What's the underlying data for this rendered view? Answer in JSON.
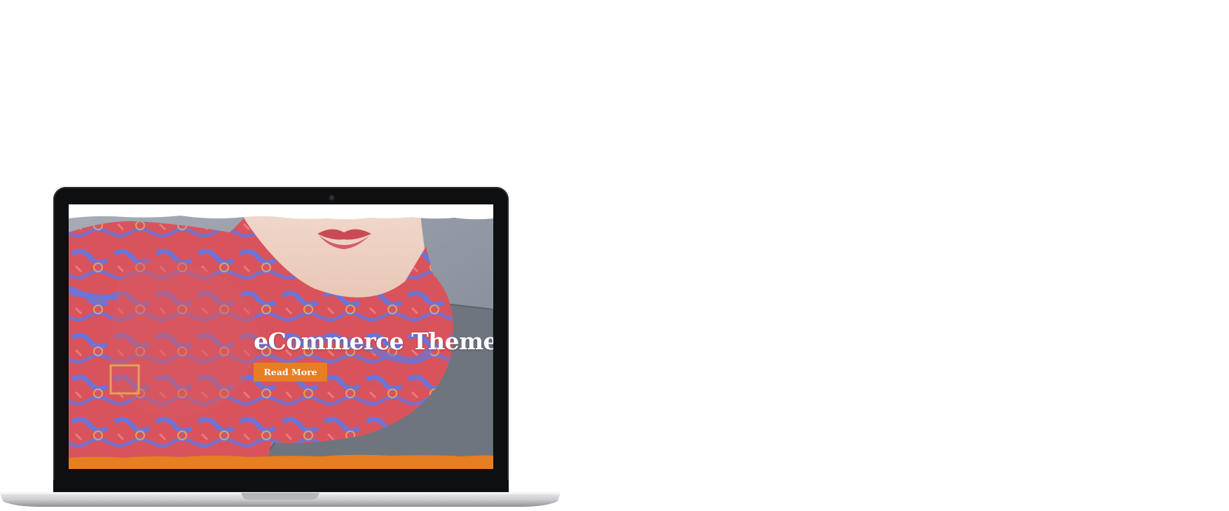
{
  "hero": {
    "title": "eCommerce Theme",
    "button_label": "Read More"
  },
  "colors": {
    "accent": "#e67e22",
    "laptop_bezel": "#0e0f11",
    "scarf_red": "#d9535c",
    "scarf_blue": "#6e73d6",
    "backdrop_gray": "#9097a3",
    "shirt_gray": "#6d747d"
  },
  "icons": {
    "camera": "webcam-dot"
  }
}
